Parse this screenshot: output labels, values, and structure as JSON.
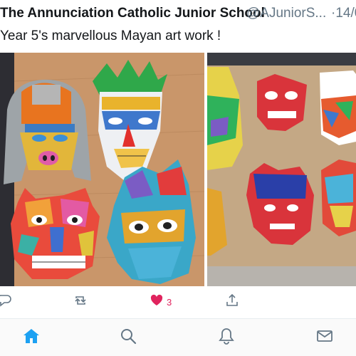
{
  "tweet": {
    "author_name": "The Annunciation Catholic Junior School",
    "author_handle": "@AJuniorS...",
    "time": "·14/0",
    "text": "Year 5's marvellous Mayan art work !",
    "likes_count": "3"
  },
  "colors": {
    "accent": "#1da1f2",
    "like": "#e0245e",
    "icon_gray": "#657786"
  },
  "actions": [
    {
      "icon": "reply-icon"
    },
    {
      "icon": "retweet-icon"
    },
    {
      "icon": "heart-icon"
    },
    {
      "icon": "share-icon"
    }
  ],
  "tabbar": [
    {
      "icon": "home-icon",
      "active": true
    },
    {
      "icon": "search-icon",
      "active": false
    },
    {
      "icon": "notifications-bell-icon",
      "active": false
    },
    {
      "icon": "messages-envelope-icon",
      "active": false
    }
  ]
}
